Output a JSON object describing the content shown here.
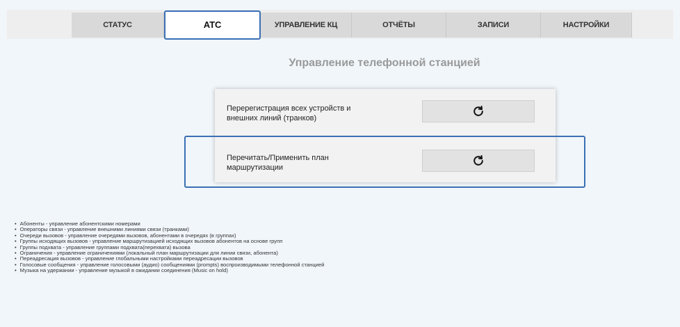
{
  "nav": {
    "tabs": [
      {
        "label": "СТАТУС"
      },
      {
        "label": "АТС"
      },
      {
        "label": "УПРАВЛЕНИЕ КЦ"
      },
      {
        "label": "ОТЧЁТЫ"
      },
      {
        "label": "ЗАПИСИ"
      },
      {
        "label": "НАСТРОЙКИ"
      }
    ],
    "active_tab": "АТС"
  },
  "page": {
    "title": "Управление телефонной станцией"
  },
  "actions": [
    {
      "label_line1": "Перерегистрация всех устройств и",
      "label_line2": "внешних линий (транков)",
      "icon": "reload-icon"
    },
    {
      "label_line1": "Перечитать/Применить план",
      "label_line2": "маршрутизации",
      "icon": "reload-icon"
    }
  ],
  "help": [
    "Абоненты - управление абонентскими номерами",
    "Операторы связи - управление внешними линиями связи (транками)",
    "Очереди вызовов - управление очередями вызовов, абонентами в очередях (в группах)",
    "Группы исходящих вызовов - управление маршрутизацией исходящих вызовов абонентов на основе групп",
    "Группы подхвата - управление группами подхвата(перехвата) вызова",
    "Ограничения - управление ограничениями (локальный план маршрутизации для линии связи, абонента)",
    "Переадресация вызовов - управление глобальными настройками переадресации вызовов",
    "Голосовые сообщения - управление голосовыми (аудио) сообщениями (prompts) воспроизводимыми телефонной станцией",
    "Музыка на удержании - управление музыкой в ожидании соединения (Music on hold)"
  ],
  "colors": {
    "accent": "#3a6fb5",
    "background": "#f1f6fa",
    "tab_bg": "#d9d9d9"
  }
}
